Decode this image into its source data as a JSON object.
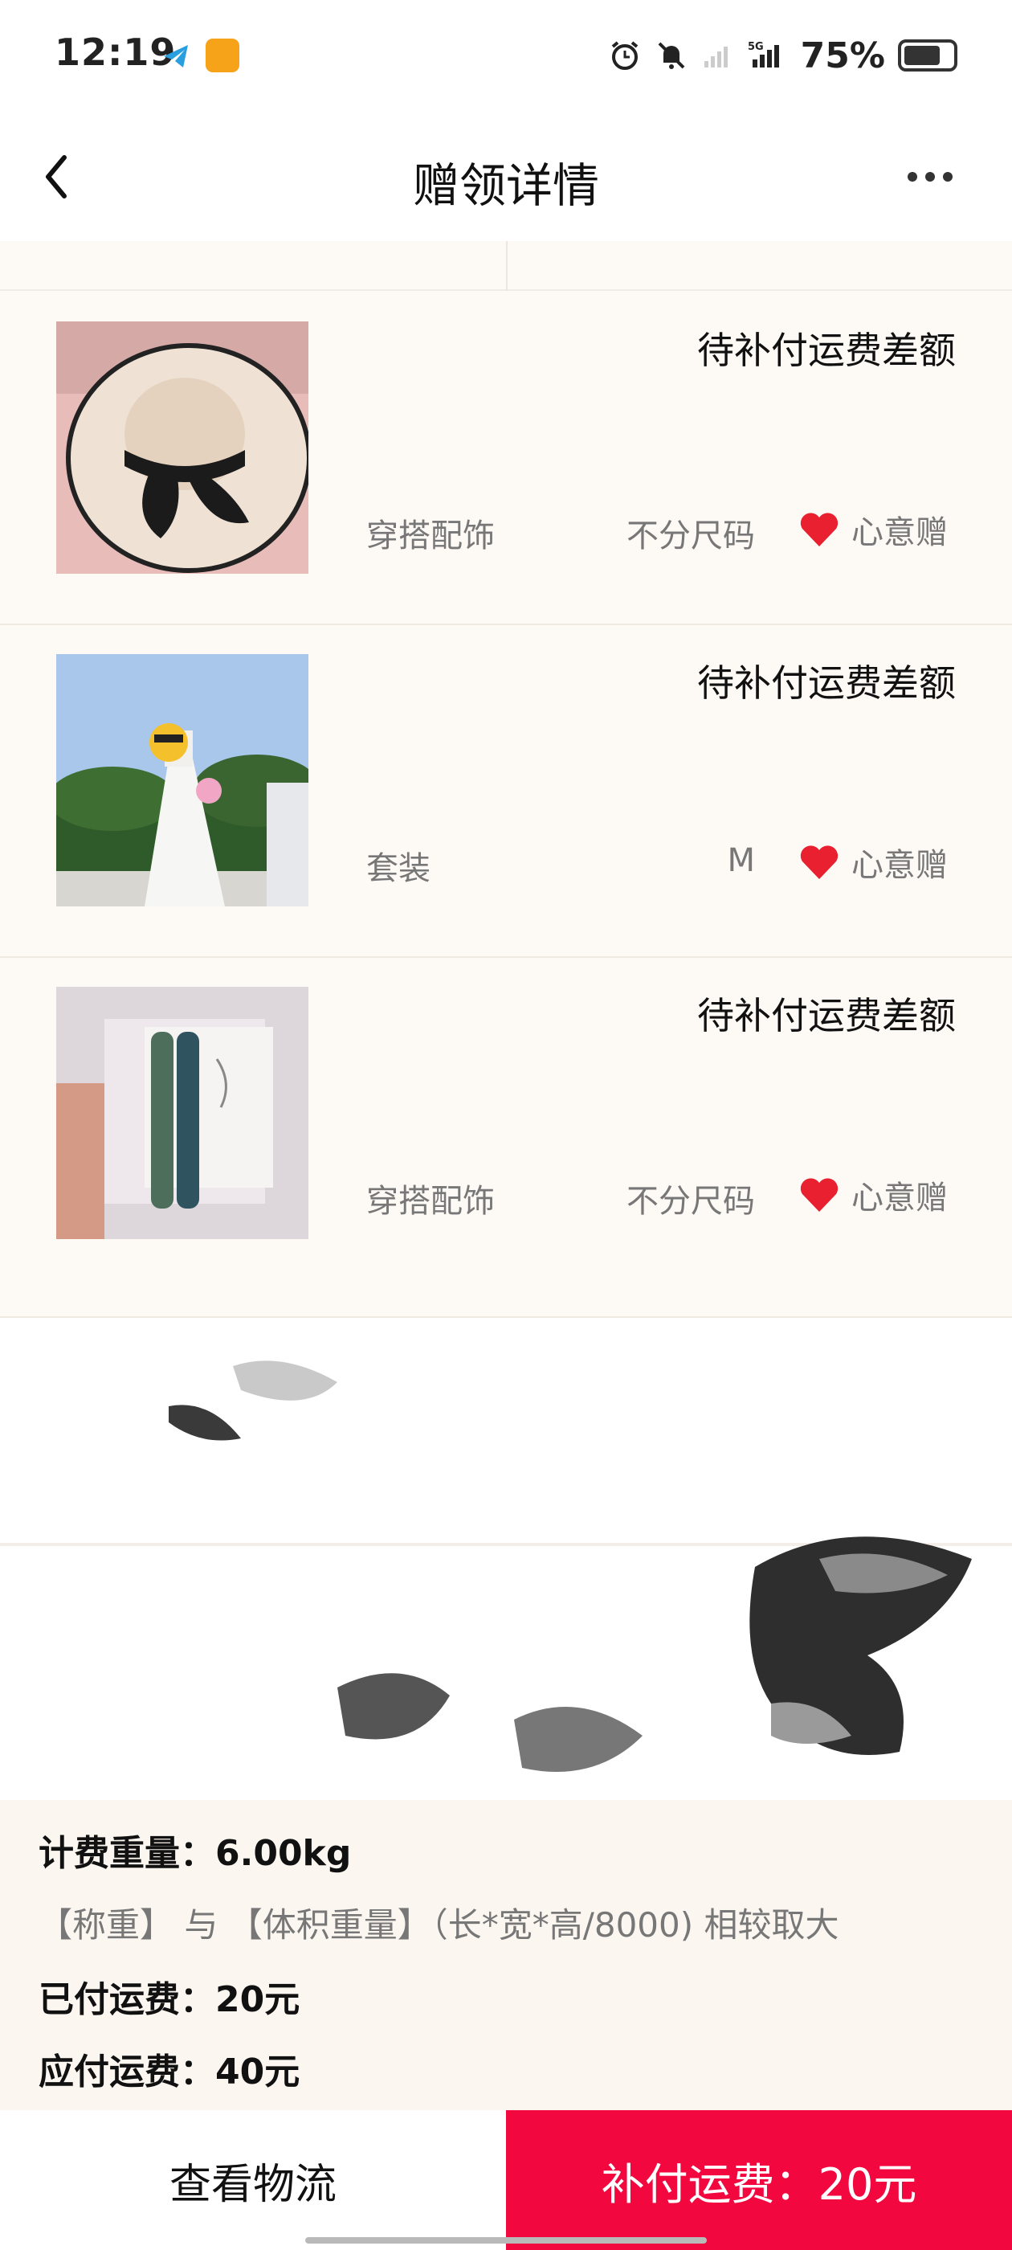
{
  "status_bar": {
    "time": "12:19",
    "network": "5G",
    "battery_percent": "75%",
    "battery_level": 0.75,
    "icons": [
      "telegram-icon",
      "app-icon",
      "alarm-icon",
      "mute-bell-icon",
      "wifi-icon",
      "signal-icon",
      "battery-icon"
    ]
  },
  "nav": {
    "title": "赠领详情",
    "back_icon": "chevron-left-icon",
    "more_icon": "more-dots-icon"
  },
  "items": [
    {
      "status": "待补付运费差额",
      "category": "穿搭配饰",
      "size": "不分尺码",
      "tag": "心意赠",
      "image": "sun-hat-photo"
    },
    {
      "status": "待补付运费差额",
      "category": "套装",
      "size": "M",
      "tag": "心意赠",
      "image": "wedding-dress-photo"
    },
    {
      "status": "待补付运费差额",
      "category": "穿搭配饰",
      "size": "不分尺码",
      "tag": "心意赠",
      "image": "hair-clips-photo"
    }
  ],
  "summary": {
    "weight_label": "计费重量：",
    "weight_value": "6.00kg",
    "note": "【称重】 与 【体积重量】（长*宽*高/8000) 相较取大",
    "paid_label": "已付运费：",
    "paid_value": "20元",
    "due_label": "应付运费：",
    "due_value": "40元"
  },
  "bottom": {
    "logistics": "查看物流",
    "pay": "补付运费：20元"
  },
  "colors": {
    "accent": "#f2073f",
    "heart": "#e8202f",
    "background": "#fdfaf6"
  }
}
